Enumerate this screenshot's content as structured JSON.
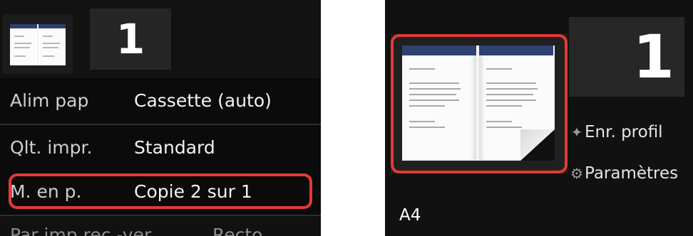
{
  "left_screen": {
    "copies": "1",
    "settings": [
      {
        "label": "Alim pap",
        "value": "Cassette (auto)"
      },
      {
        "label": "Qlt. impr.",
        "value": "Standard"
      },
      {
        "label": "M. en p.",
        "value": "Copie 2 sur 1"
      }
    ],
    "partial_row": {
      "label": "Par imp rec.-ver.",
      "value": "Recto"
    },
    "highlight_color": "#e33a38"
  },
  "right_screen": {
    "copies": "1",
    "save_profile_label": "Enr. profil",
    "settings_label": "Paramètres",
    "paper_size": "A4",
    "icons": {
      "save_profile": "star-plus-icon",
      "settings": "gear-icon"
    },
    "highlight_color": "#e33a38"
  }
}
